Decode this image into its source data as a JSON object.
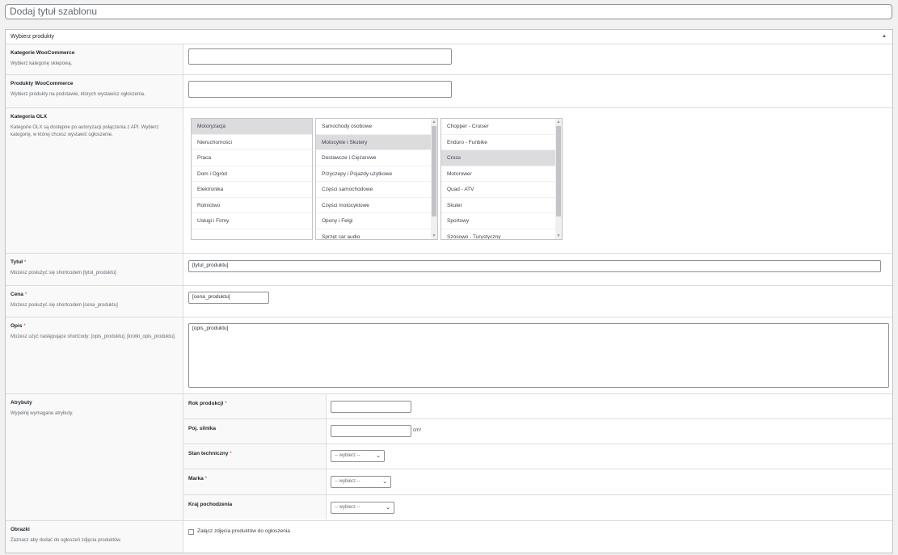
{
  "template_title": {
    "placeholder": "Dodaj tytuł szablonu"
  },
  "box": {
    "header": "Wybierz produkty",
    "toggle_icon": "arrow-up-icon"
  },
  "rows": {
    "woo_categories": {
      "name": "Kategorie WooCommerce",
      "desc": "Wybierz kategorię sklepową."
    },
    "woo_products": {
      "name": "Produkty WooCommerce",
      "desc": "Wybierz produkty na podstawie, których wystawisz ogłoszenia."
    },
    "olx_category": {
      "name": "Kategoria OLX",
      "desc": "Kategorie OLX są dostępne po autoryzacji połączenia z API. Wybierz kategorię, w której chcesz wystawić ogłoszenie.",
      "list1": [
        "Motoryzacja",
        "Nieruchomości",
        "Praca",
        "Dom i Ogród",
        "Elektronika",
        "Rolnictwo",
        "Usługi i Firmy"
      ],
      "list2": [
        "Samochody osobowe",
        "Motocykle i Skutery",
        "Dostawcze i Ciężarowe",
        "Przyczepy i Pojazdy użytkowe",
        "Części samochodowe",
        "Części motocyklowe",
        "Opony i Felgi",
        "Sprzęt car audio"
      ],
      "list3": [
        "Chopper - Cruiser",
        "Enduro - Funbike",
        "Cross",
        "Motorower",
        "Quad - ATV",
        "Skuter",
        "Sportowy",
        "Szosowo - Turystyczny"
      ]
    },
    "title": {
      "name": "Tytuł",
      "required": "*",
      "desc": "Możesz posłużyć się shortcodem [tytul_produktu]",
      "value": "[tytul_produktu]"
    },
    "price": {
      "name": "Cena",
      "required": "*",
      "desc": "Możesz posłużyć się shortcodem [cena_produktu]",
      "value": "[cena_produktu]"
    },
    "description": {
      "name": "Opis",
      "required": "*",
      "desc": "Możesz użyć następujące shortcody: [opis_produktu], [krotki_opis_produktu].",
      "value": "[opis_produktu]"
    },
    "attributes": {
      "name": "Atrybuty",
      "desc": "Wypełnij wymagane atrybuty.",
      "items": [
        {
          "label": "Rok produkcji",
          "required": "*"
        },
        {
          "label": "Poj. silnika",
          "required": "",
          "unit": "cm³"
        },
        {
          "label": "Stan techniczny",
          "required": "*",
          "select": "-- wybierz --"
        },
        {
          "label": "Marka",
          "required": "*",
          "select": "-- wybierz --"
        },
        {
          "label": "Kraj pochodzenia",
          "required": "",
          "select": "-- wybierz --"
        }
      ]
    },
    "images": {
      "name": "Obrazki",
      "desc": "Zaznacz aby dodać do ogłoszeń zdjęcia produktów.",
      "checkbox_label": "Załącz zdjęcia produktów do ogłoszenia"
    }
  },
  "colors": {
    "required": "#d63638",
    "selected_bg": "#dcdcde"
  }
}
